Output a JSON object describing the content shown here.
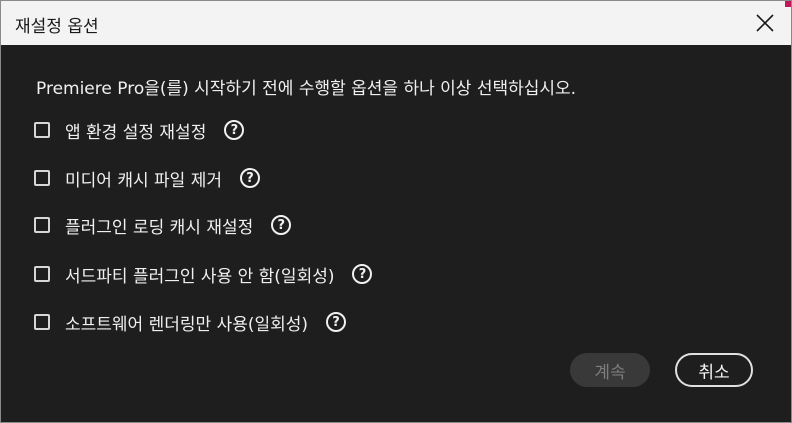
{
  "dialog": {
    "title": "재설정 옵션",
    "close_icon": "close-icon",
    "prompt": "Premiere Pro을(를) 시작하기 전에 수행할 옵션을 하나 이상 선택하십시오.",
    "options": [
      {
        "label": "앱 환경 설정 재설정",
        "checked": false
      },
      {
        "label": "미디어 캐시 파일 제거",
        "checked": false
      },
      {
        "label": "플러그인 로딩 캐시 재설정",
        "checked": false
      },
      {
        "label": "서드파티 플러그인 사용 안 함(일회성)",
        "checked": false
      },
      {
        "label": "소프트웨어 렌더링만 사용(일회성)",
        "checked": false
      }
    ],
    "help_glyph": "?",
    "buttons": {
      "continue_label": "계속",
      "continue_enabled": false,
      "cancel_label": "취소"
    }
  },
  "colors": {
    "background": "#1e1e1e",
    "titlebar": "#f3f3f3",
    "text": "#f0f0f0",
    "disabled_button": "#393939"
  }
}
